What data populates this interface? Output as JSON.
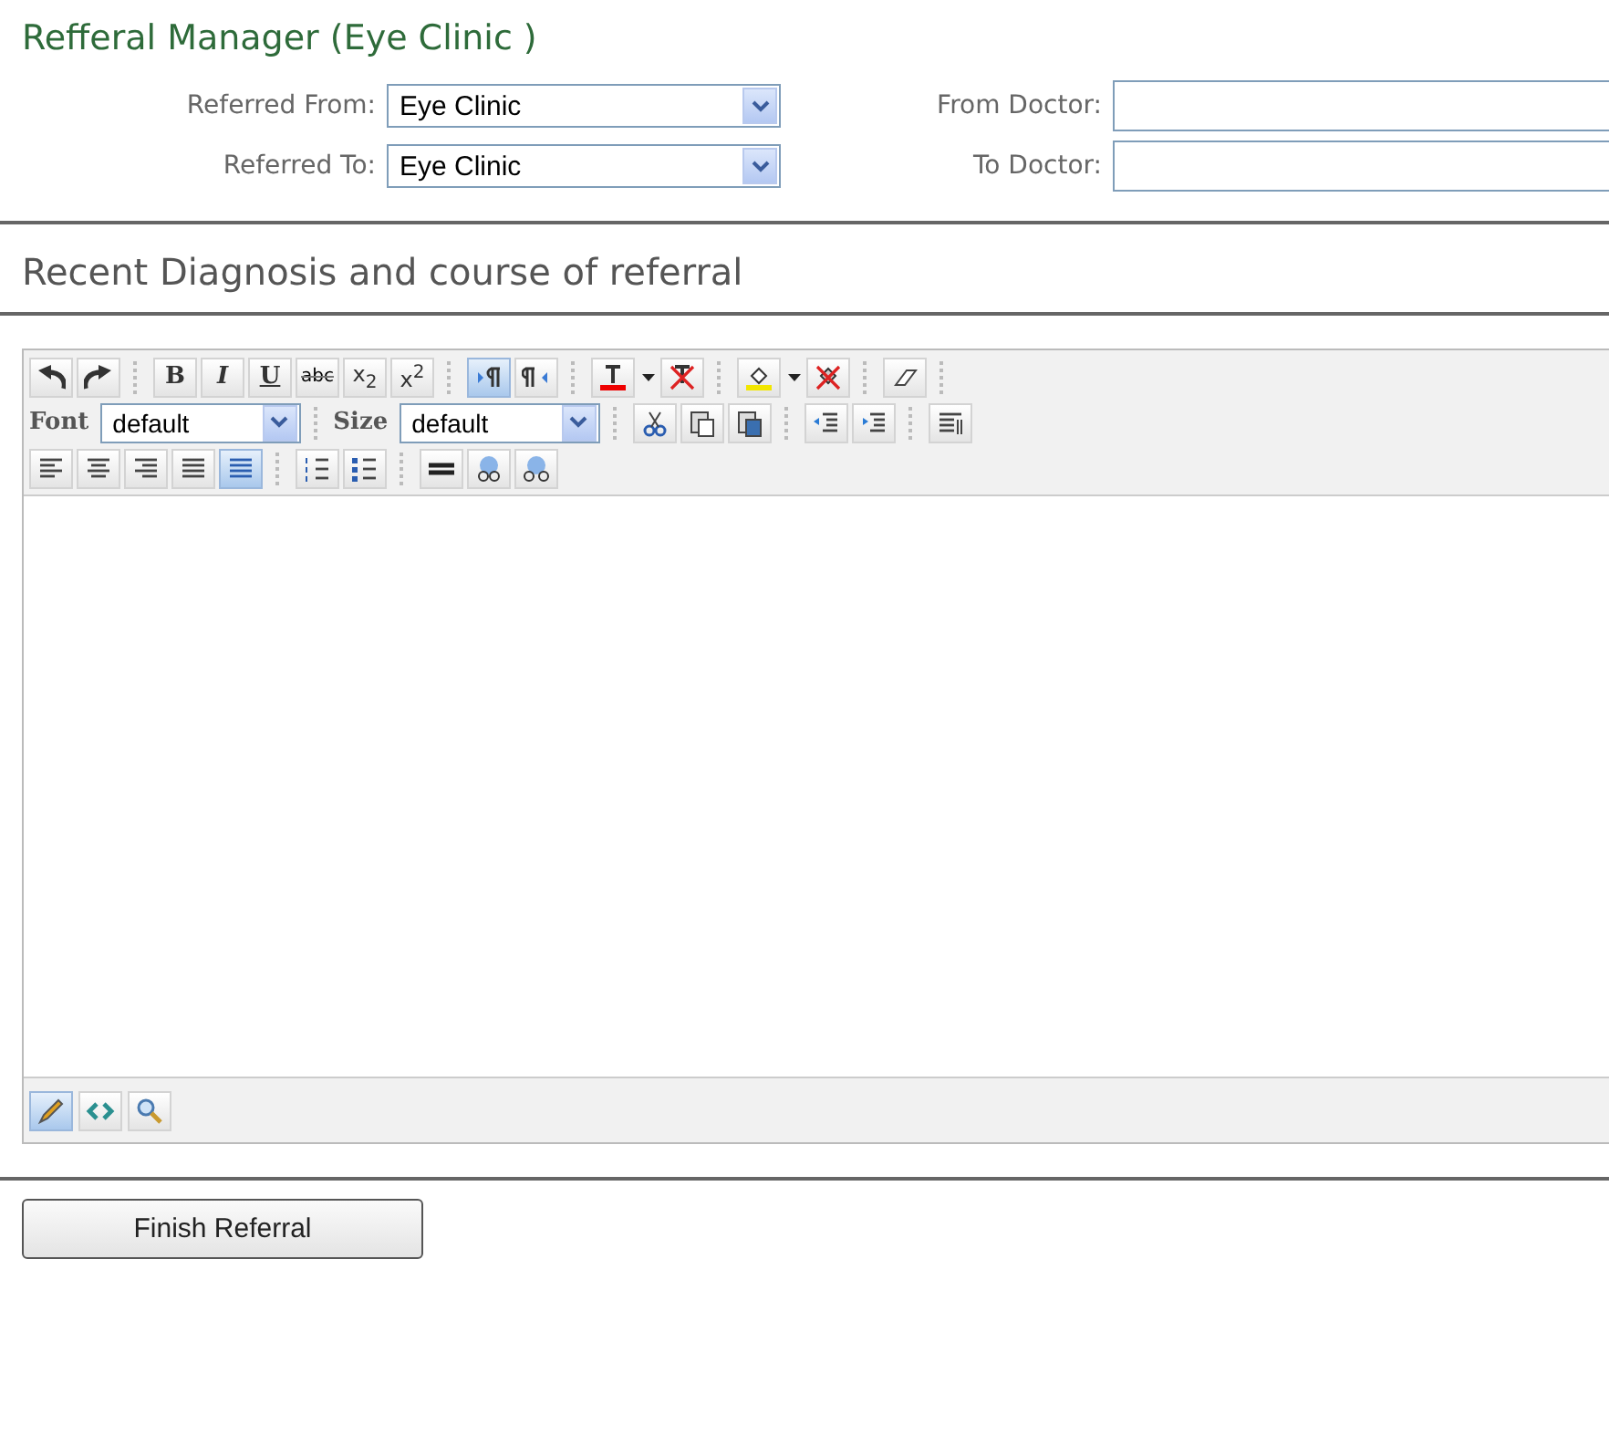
{
  "title": "Refferal Manager (Eye Clinic )",
  "form": [
    {
      "label": "Referred From:",
      "value": "Eye Clinic",
      "doctor_label": "From Doctor:"
    },
    {
      "label": "Referred To:",
      "value": "Eye Clinic",
      "doctor_label": "To Doctor:"
    }
  ],
  "section_title": "Recent Diagnosis and course of referral",
  "toolbar": {
    "rows": [
      [
        {
          "kind": "icon",
          "selected": false
        },
        {
          "kind": "icon",
          "selected": false
        },
        {
          "kind": "sep"
        },
        {
          "kind": "bold",
          "label": "B",
          "selected": false
        },
        {
          "kind": "italic",
          "label": "I",
          "selected": false
        },
        {
          "kind": "underline",
          "label": "U",
          "selected": false
        },
        {
          "kind": "strike",
          "label": "abc",
          "selected": false
        },
        {
          "kind": "script",
          "label": "x$_{2}$",
          "selected": false
        },
        {
          "kind": "script",
          "label": "x$^{2}$",
          "selected": false
        },
        {
          "kind": "sep"
        },
        {
          "kind": "icon",
          "selected": true
        },
        {
          "kind": "icon",
          "selected": false
        },
        {
          "kind": "sep"
        },
        {
          "kind": "icon",
          "selected": false
        },
        {
          "kind": "arrow"
        },
        {
          "kind": "icon",
          "selected": false
        },
        {
          "kind": "sep"
        },
        {
          "kind": "icon",
          "selected": false
        },
        {
          "kind": "arrow"
        },
        {
          "kind": "icon",
          "selected": false
        },
        {
          "kind": "sep"
        },
        {
          "kind": "icon",
          "selected": false
        },
        {
          "kind": "sep"
        }
      ],
      [
        {
          "kind": "select",
          "label": "Font",
          "value": "default"
        },
        {
          "kind": "sep"
        },
        {
          "kind": "select",
          "label": "Size",
          "value": "default"
        },
        {
          "kind": "sep"
        },
        {
          "kind": "icon",
          "selected": false
        },
        {
          "kind": "icon",
          "selected": false
        },
        {
          "kind": "icon",
          "selected": false
        },
        {
          "kind": "sep"
        },
        {
          "kind": "icon",
          "selected": false
        },
        {
          "kind": "icon",
          "selected": false
        },
        {
          "kind": "sep"
        },
        {
          "kind": "icon",
          "selected": false
        }
      ],
      [
        {
          "kind": "icon",
          "selected": false
        },
        {
          "kind": "icon",
          "selected": false
        },
        {
          "kind": "icon",
          "selected": false
        },
        {
          "kind": "icon",
          "selected": false
        },
        {
          "kind": "icon",
          "selected": true
        },
        {
          "kind": "sep"
        },
        {
          "kind": "icon",
          "selected": false
        },
        {
          "kind": "icon",
          "selected": false
        },
        {
          "kind": "sep"
        },
        {
          "kind": "icon",
          "selected": false
        },
        {
          "kind": "icon",
          "selected": false
        },
        {
          "kind": "icon",
          "selected": false
        }
      ]
    ]
  },
  "modes": [
    {
      "selected": true
    },
    {
      "selected": false
    },
    {
      "selected": false
    }
  ],
  "finish_button": "Finish Referral"
}
